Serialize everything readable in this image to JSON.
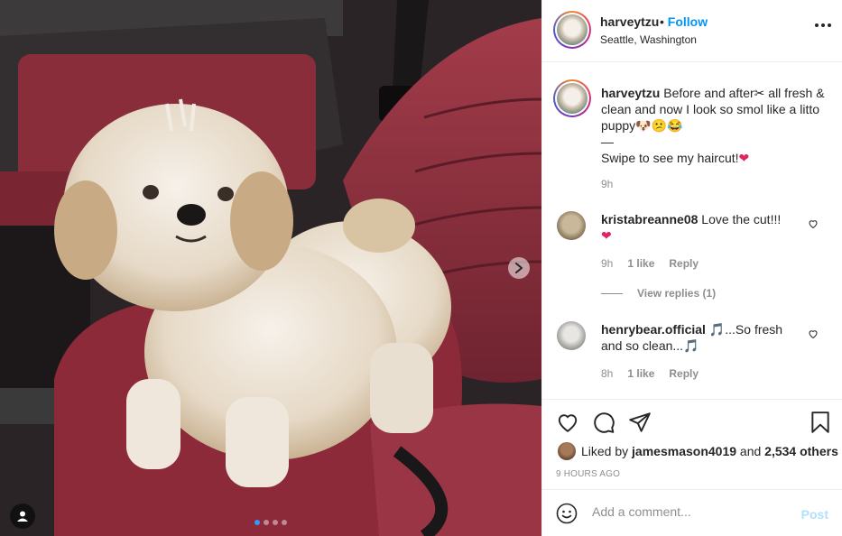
{
  "post": {
    "username": "harveytzu",
    "follow_label": "Follow",
    "bullet": "•",
    "location": "Seattle, Washington",
    "carousel_total_dots": 4,
    "active_dot": 1
  },
  "caption": {
    "username": "harveytzu",
    "text_line1": " Before and after",
    "text_after_scissors": " all fresh & clean and now I look so smol like a litto puppy",
    "emojis_end": "🐶😕😂",
    "scissors": "✂",
    "dash": "—",
    "swipe_text": "Swipe to see my haircut!",
    "heart": "❤",
    "time": "9h"
  },
  "comments": [
    {
      "username": "kristabreanne08",
      "text": " Love the cut!!! ",
      "emoji": "❤",
      "time": "9h",
      "likes": "1 like",
      "reply": "Reply",
      "view_replies": "View replies (1)"
    },
    {
      "username": "henrybear.official",
      "text_before": " ",
      "emoji1": "🎵",
      "text_middle": "...So fresh and so clean...",
      "emoji2": "🎵",
      "time": "8h",
      "likes": "1 like",
      "reply": "Reply"
    }
  ],
  "likes": {
    "prefix": "Liked by ",
    "user": "jamesmason4019",
    "middle": " and ",
    "others": "2,534 others"
  },
  "time_ago": "9 HOURS AGO",
  "add_comment": {
    "placeholder": "Add a comment...",
    "post_label": "Post"
  },
  "colors": {
    "accent": "#0095f6",
    "post_disabled": "#b2dffc",
    "secondary_text": "#8e8e8e"
  }
}
